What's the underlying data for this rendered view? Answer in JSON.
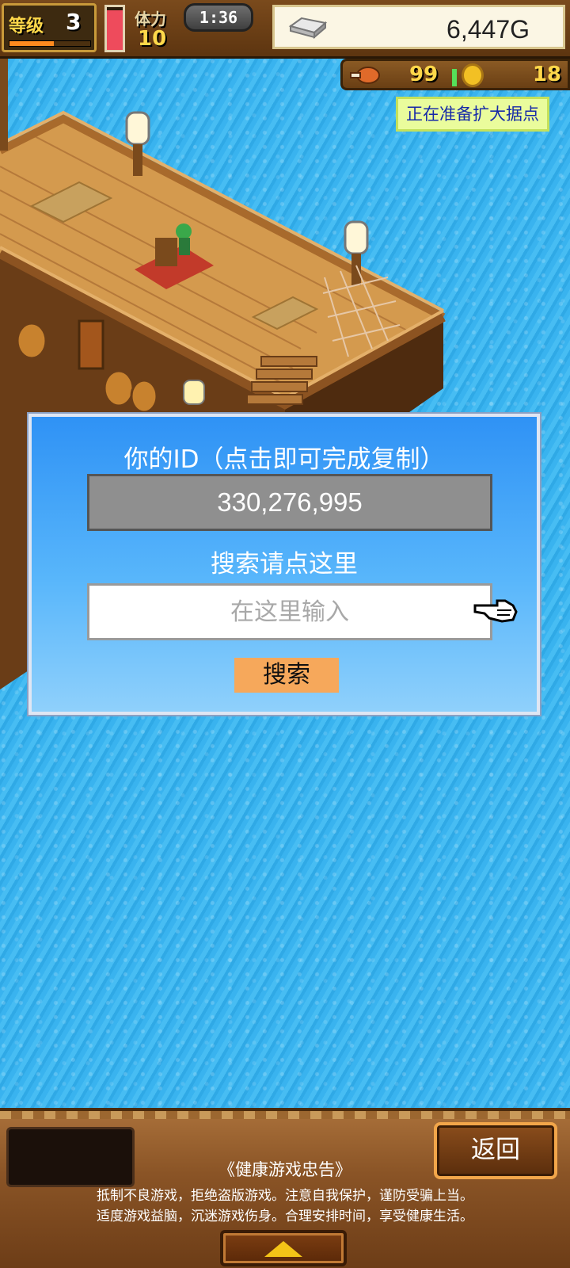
{
  "hud": {
    "level_label": "等级",
    "level_value": "3",
    "exp_progress": 0.55,
    "stamina_gauge_fraction": 0.92,
    "stamina_label": "体力",
    "stamina_value": "10",
    "time": "1:36",
    "gold": "6,447G",
    "food": "99",
    "coins": "18",
    "status_text": "正在准备扩大据点"
  },
  "dialog": {
    "id_title": "你的ID（点击即可完成复制）",
    "id_value": "330,276,995",
    "search_title": "搜索请点这里",
    "search_placeholder": "在这里输入",
    "search_value": "",
    "search_button": "搜索"
  },
  "bottom": {
    "back_button": "返回",
    "notice_title": "《健康游戏忠告》",
    "notice_line1": "抵制不良游戏，拒绝盗版游戏。注意自我保护，谨防受骗上当。",
    "notice_line2": "适度游戏益脑，沉迷游戏伤身。合理安排时间，享受健康生活。"
  },
  "icons": {
    "silver": "silver-ingot-icon",
    "food": "meat-icon",
    "coin": "medal-coin-icon",
    "pointer": "pointing-hand-icon",
    "expand": "arrow-up-icon"
  },
  "colors": {
    "sea": "#3bb2ee",
    "dialog_top": "#2f92f5",
    "dialog_bottom": "#8fd0fb",
    "search_button": "#f6a85b",
    "status_tag_bg": "#eafc9c",
    "status_tag_text": "#1629a8"
  }
}
